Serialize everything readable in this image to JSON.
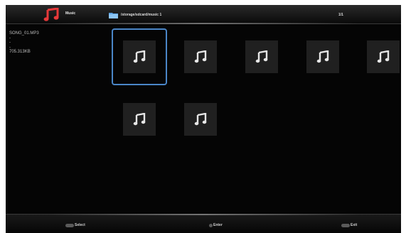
{
  "header": {
    "app_title": "Music",
    "path": "/storage/sdcard/music 1",
    "page_count": "1/1"
  },
  "info": {
    "filename": "SONG_01.MP3",
    "line2": "-",
    "line3": "-",
    "line4": "-",
    "size": "705.313KB"
  },
  "files": [
    {
      "icon": "music-note-icon",
      "selected": true
    },
    {
      "icon": "music-note-icon",
      "selected": false
    },
    {
      "icon": "music-note-icon",
      "selected": false
    },
    {
      "icon": "music-note-icon",
      "selected": false
    },
    {
      "icon": "music-note-icon",
      "selected": false
    },
    {
      "icon": "music-note-icon",
      "selected": false
    },
    {
      "icon": "music-note-icon",
      "selected": false
    }
  ],
  "footer": {
    "select_label": "Select",
    "enter_label": "Enter",
    "exit_label": "Exit"
  },
  "colors": {
    "selection": "#4a86c8",
    "app_icon": "#e8393a",
    "folder": "#5aa3e6"
  }
}
